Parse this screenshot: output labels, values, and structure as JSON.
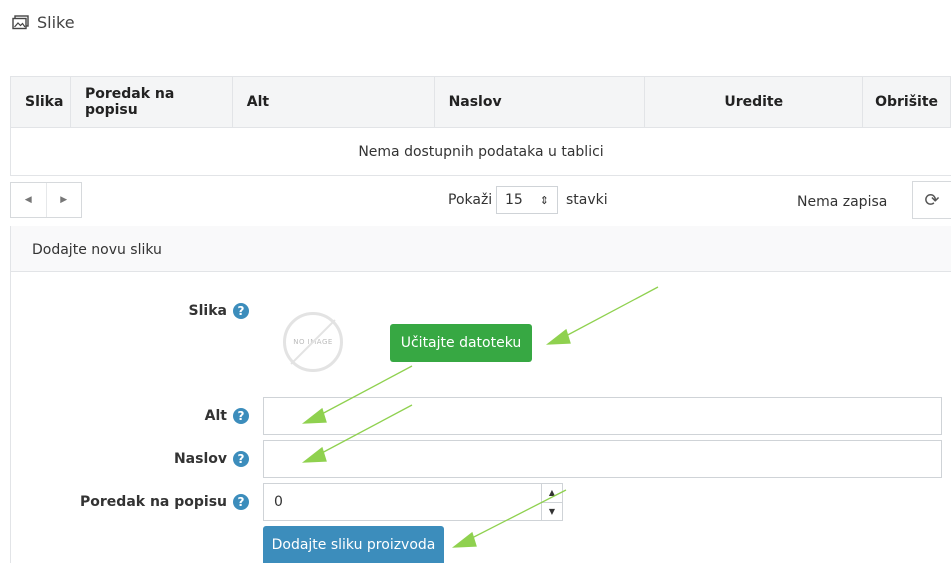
{
  "header": {
    "icon": "images-icon",
    "title": "Slike"
  },
  "table": {
    "columns": [
      "Slika",
      "Poredak na popisu",
      "Alt",
      "Naslov",
      "Uredite",
      "Obrišite"
    ],
    "empty_message": "Nema dostupnih podataka u tablici"
  },
  "pager": {
    "prev_icon": "caret-left-icon",
    "next_icon": "caret-right-icon",
    "show_label": "Pokaži",
    "page_size": "15",
    "page_size_suffix": "stavki",
    "records_info": "Nema zapisa",
    "refresh_icon": "refresh-icon"
  },
  "panel": {
    "title": "Dodajte novu sliku",
    "image_label": "Slika",
    "no_image_text": "NO IMAGE",
    "upload_button": "Učitajte datoteku",
    "alt_label": "Alt",
    "alt_value": "",
    "title_label": "Naslov",
    "title_value": "",
    "order_label": "Poredak na popisu",
    "order_value": "0",
    "submit_button": "Dodajte sliku proizvoda",
    "help_glyph": "?"
  },
  "colors": {
    "green": "#37a843",
    "blue": "#3c8dbc",
    "arrow": "#8fd14f"
  }
}
